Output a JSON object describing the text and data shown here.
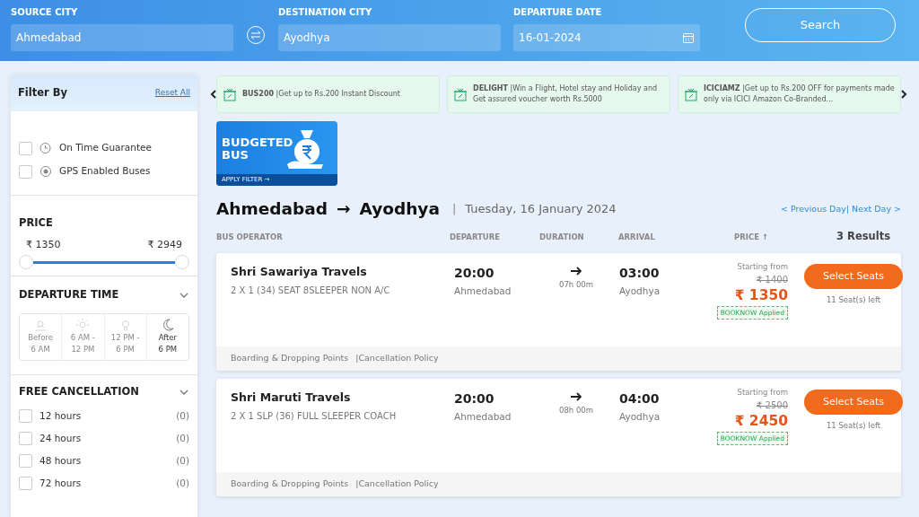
{
  "search_bar": {
    "fields": [
      {
        "label": "SOURCE CITY",
        "value": "Ahmedabad",
        "kind": "text"
      },
      {
        "label": "DESTINATION CITY",
        "value": "Ayodhya",
        "kind": "text"
      },
      {
        "label": "DEPARTURE DATE",
        "value": "16-01-2024",
        "kind": "date"
      }
    ],
    "button": "Search"
  },
  "filters": {
    "title": "Filter By",
    "reset": "Reset All",
    "toggles": [
      {
        "label": "On Time Guarantee",
        "checked": false,
        "kind": "clock"
      },
      {
        "label": "GPS Enabled Buses",
        "checked": false,
        "kind": "gps"
      }
    ],
    "price": {
      "title": "PRICE",
      "min": "₹ 1350",
      "max": "₹ 2949"
    },
    "departure_time": {
      "title": "DEPARTURE TIME",
      "expanded": true,
      "slots": [
        {
          "line1": "Before",
          "line2": "6 AM",
          "kind": "sunrise",
          "disabled": true
        },
        {
          "line1": "6 AM -",
          "line2": "12 PM",
          "kind": "sun",
          "disabled": true
        },
        {
          "line1": "12 PM -",
          "line2": "6 PM",
          "kind": "bulb",
          "disabled": true
        },
        {
          "line1": "After",
          "line2": "6 PM",
          "kind": "moon",
          "disabled": false
        }
      ]
    },
    "free_cancellation": {
      "title": "FREE CANCELLATION",
      "expanded": true,
      "options": [
        {
          "label": "12 hours",
          "count": "(0)",
          "checked": false
        },
        {
          "label": "24 hours",
          "count": "(0)",
          "checked": false
        },
        {
          "label": "48 hours",
          "count": "(0)",
          "checked": false
        },
        {
          "label": "72 hours",
          "count": "(0)",
          "checked": false
        }
      ]
    }
  },
  "offers": [
    {
      "code": "BUS200",
      "text": "|Get up to Rs.200 Instant Discount"
    },
    {
      "code": "DELIGHT",
      "text": "|Win a Flight, Hotel stay and Holiday and Get assured voucher worth Rs.5000"
    },
    {
      "code": "ICICIAMZ",
      "text": "|Get up to Rs.200 OFF for payments made only via ICICI Amazon Co-Branded..."
    }
  ],
  "banner": {
    "title": "BUDGETED BUS",
    "action": "APPLY FILTER →"
  },
  "route": {
    "from": "Ahmedabad",
    "arrow": "→",
    "to": "Ayodhya",
    "separator": "|",
    "date": "Tuesday, 16 January 2024",
    "prev": "< Previous Day",
    "next": "| Next Day >"
  },
  "columns": [
    "BUS OPERATOR",
    "DEPARTURE",
    "DURATION",
    "ARRIVAL",
    "PRICE ↑"
  ],
  "results_count": "3 Results",
  "buses": [
    {
      "operator": "Shri Sawariya Travels",
      "type": "2 X 1 (34) SEAT 8SLEEPER NON A/C",
      "departure": "20:00",
      "from": "Ahmedabad",
      "duration": "07h 00m",
      "arrival": "03:00",
      "to": "Ayodhya",
      "starting": "Starting from",
      "old_price": "₹ 1400",
      "price": "₹ 1350",
      "coupon": "BOOKNOW Applied",
      "button": "Select Seats",
      "seats": "11 Seat(s) left",
      "boarding": "Boarding & Dropping Points",
      "cancellation": "|Cancellation Policy"
    },
    {
      "operator": "Shri Maruti Travels",
      "type": "2 X 1 SLP (36) FULL SLEEPER COACH",
      "departure": "20:00",
      "from": "Ahmedabad",
      "duration": "08h 00m",
      "arrival": "04:00",
      "to": "Ayodhya",
      "starting": "Starting from",
      "old_price": "₹ 2500",
      "price": "₹ 2450",
      "coupon": "BOOKNOW Applied",
      "button": "Select Seats",
      "seats": "11 Seat(s) left",
      "boarding": "Boarding & Dropping Points",
      "cancellation": "|Cancellation Policy"
    }
  ]
}
